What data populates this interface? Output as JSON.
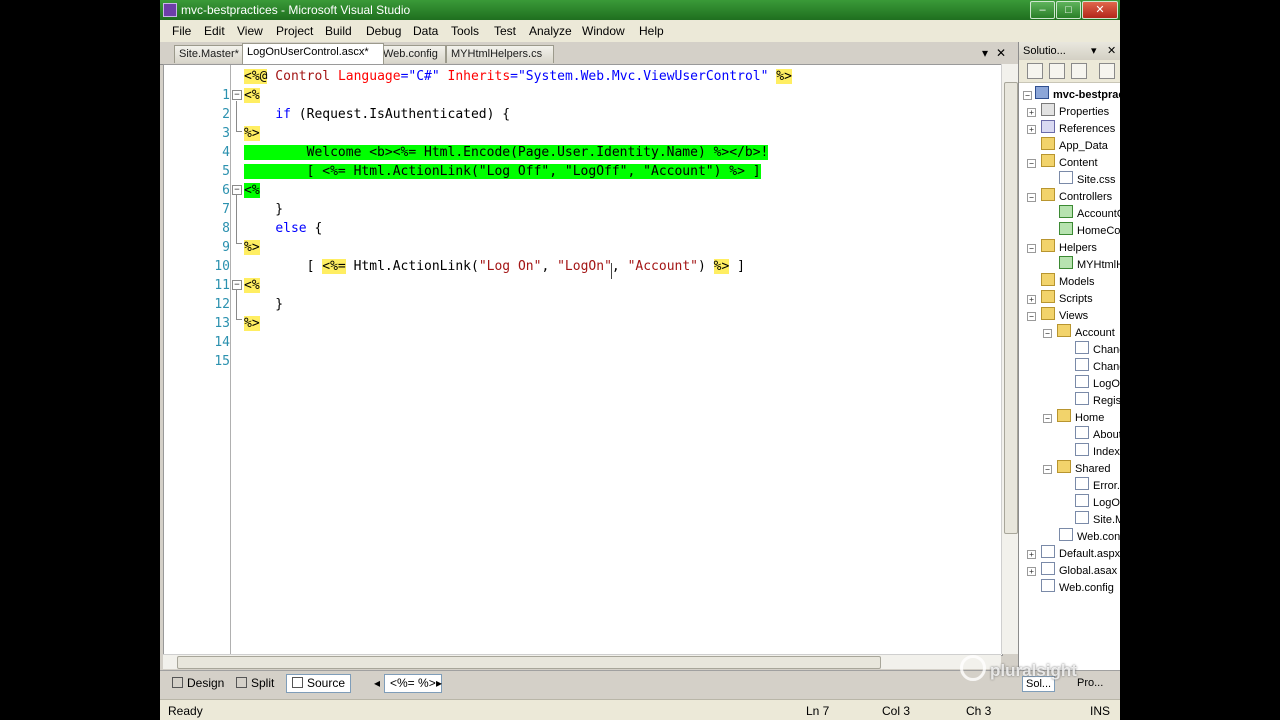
{
  "window": {
    "title": "mvc-bestpractices - Microsoft Visual Studio",
    "minimize": "0",
    "maximize": "1",
    "close": "r"
  },
  "menu": [
    "File",
    "Edit",
    "View",
    "Project",
    "Build",
    "Debug",
    "Data",
    "Tools",
    "Test",
    "Analyze",
    "Window",
    "Help"
  ],
  "tabs": [
    "Site.Master*",
    "LogOnUserControl.ascx*",
    "Web.config",
    "MYHtmlHelpers.cs"
  ],
  "tab_controls": {
    "dropdown": "▾",
    "close": "✕"
  },
  "code": {
    "line_numbers": [
      "1",
      "2",
      "3",
      "4",
      "5",
      "6",
      "7",
      "8",
      "9",
      "10",
      "11",
      "12",
      "13",
      "14",
      "15"
    ],
    "l1": {
      "open": "<%@",
      "control": " Control ",
      "lang_attr": "Language",
      "lang_val": "=\"C#\"",
      "inh_attr": " Inherits",
      "inh_val": "=\"System.Web.Mvc.ViewUserControl\"",
      "close": "%>"
    },
    "l2": "<%",
    "l3": {
      "indent": "    ",
      "kw": "if",
      "rest": " (Request.IsAuthenticated) {"
    },
    "l4": "%>",
    "l5": "        Welcome <b><%= Html.Encode(Page.User.Identity.Name) %></b>!",
    "l6": "        [ <%= Html.ActionLink(\"Log Off\", \"LogOff\", \"Account\") %> ]",
    "l7": "<%",
    "l8": "    }",
    "l9": {
      "indent": "    ",
      "kw": "else",
      "rest": " {"
    },
    "l10": "%>",
    "l11": {
      "pre": "        [ ",
      "open": "<%=",
      "mid": " Html.ActionLink(",
      "s1": "\"Log On\"",
      "c1": ", ",
      "s2": "\"LogOn\"",
      "c2": ", ",
      "s3": "\"Account\"",
      "end": ") ",
      "close": "%>",
      "post": " ]"
    },
    "l12": "<%",
    "l13": "    }",
    "l14": "%>"
  },
  "view_tabs": {
    "design": "Design",
    "split": "Split",
    "source": "Source",
    "nav_left": "◂",
    "tag": "<%= %>",
    "nav_right": "▸"
  },
  "solution": {
    "header": "Solutio...",
    "header_pin": "▾",
    "header_close": "✕",
    "nodes": [
      {
        "label": "mvc-bestpractices",
        "bold": true
      },
      {
        "label": "Properties"
      },
      {
        "label": "References"
      },
      {
        "label": "App_Data"
      },
      {
        "label": "Content"
      },
      {
        "label": "Site.css"
      },
      {
        "label": "Controllers"
      },
      {
        "label": "AccountController.cs"
      },
      {
        "label": "HomeController.cs"
      },
      {
        "label": "Helpers"
      },
      {
        "label": "MYHtmlHelpers.cs"
      },
      {
        "label": "Models"
      },
      {
        "label": "Scripts"
      },
      {
        "label": "Views"
      },
      {
        "label": "Account"
      },
      {
        "label": "ChangePassword.aspx"
      },
      {
        "label": "ChangePasswordSuccess.aspx"
      },
      {
        "label": "LogOn.aspx"
      },
      {
        "label": "Register.aspx"
      },
      {
        "label": "Home"
      },
      {
        "label": "About.aspx"
      },
      {
        "label": "Index.aspx"
      },
      {
        "label": "Shared"
      },
      {
        "label": "Error.aspx"
      },
      {
        "label": "LogOnUserControl.ascx"
      },
      {
        "label": "Site.Master"
      },
      {
        "label": "Web.config"
      },
      {
        "label": "Default.aspx"
      },
      {
        "label": "Global.asax"
      },
      {
        "label": "Web.config"
      }
    ],
    "bottom_tabs": [
      "Sol...",
      "Pro..."
    ]
  },
  "status": {
    "text": "Ready",
    "line": "Ln 7",
    "col": "Col 3",
    "ch": "Ch 3",
    "mode": "INS"
  },
  "watermark": "pluralsight"
}
